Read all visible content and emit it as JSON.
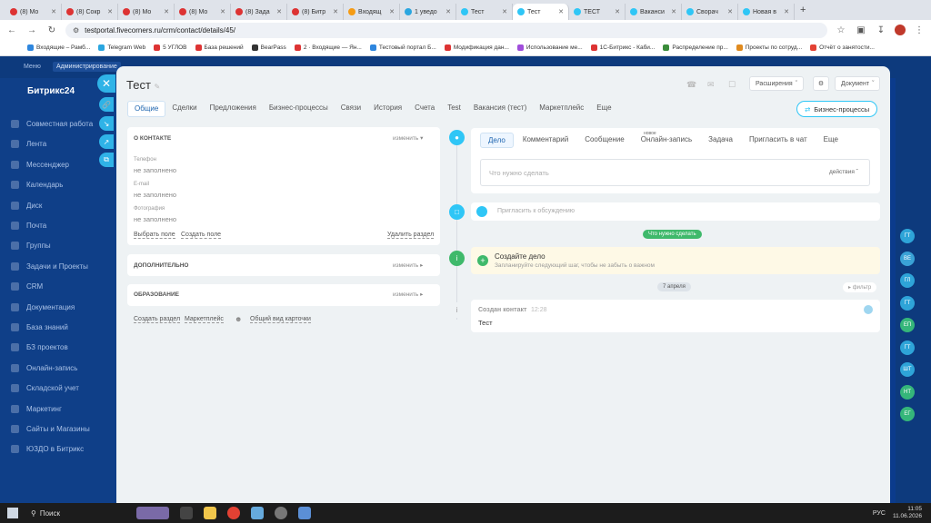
{
  "browser": {
    "tabs": [
      {
        "label": "(8) Мо",
        "color": "#d33"
      },
      {
        "label": "(8) Сокр",
        "color": "#d33"
      },
      {
        "label": "(8) Мо",
        "color": "#d33"
      },
      {
        "label": "(8) Мо",
        "color": "#d33"
      },
      {
        "label": "(8) Зада",
        "color": "#d33"
      },
      {
        "label": "(8) Битр",
        "color": "#d33"
      },
      {
        "label": "Входящ",
        "color": "#f59b14"
      },
      {
        "label": "1 уведо",
        "color": "#2aa6e0"
      },
      {
        "label": "Тест",
        "color": "#2fc6f6"
      },
      {
        "label": "Тест",
        "color": "#2fc6f6",
        "active": true
      },
      {
        "label": "ТЕСТ",
        "color": "#2fc6f6"
      },
      {
        "label": "Ваканси",
        "color": "#2fc6f6"
      },
      {
        "label": "Сворач",
        "color": "#2fc6f6"
      },
      {
        "label": "Новая в",
        "color": "#2fc6f6"
      }
    ],
    "url": "testportal.fivecorners.ru/crm/contact/details/45/",
    "bookmarks": [
      "Входящие – Рамб...",
      "Telegram Web",
      "5 УГЛОВ",
      "База решений",
      "BearPass",
      "2 · Входящие — Ян...",
      "Тестовый портал Б...",
      "Модификация дан...",
      "Использование ме...",
      "1С-Битрикс - Каби...",
      "Распределение пр...",
      "Проекты по сотруд...",
      "Отчёт о занятости..."
    ]
  },
  "bitrix": {
    "logo": "Битрикс24",
    "top_left": "Меню",
    "top_admin": "Администрирование",
    "menu": [
      "Совместная работа",
      "Лента",
      "Мессенджер",
      "Календарь",
      "Диск",
      "Почта",
      "Группы",
      "Задачи и Проекты",
      "CRM",
      "Документация",
      "База знаний",
      "БЗ проектов",
      "Онлайн-запись",
      "Складской учет",
      "Маркетинг",
      "Сайты и Магазины",
      "ЮЗДО в Битрикс"
    ],
    "right_avatars": [
      {
        "text": "ГТ",
        "color": "#2ea4d8"
      },
      {
        "text": "ВЕ",
        "color": "#3aa2d6"
      },
      {
        "text": "ГЛ",
        "color": "#2ea4d8"
      },
      {
        "text": "ГТ",
        "color": "#2ea4d8"
      },
      {
        "text": "ЕП",
        "color": "#35b67a"
      },
      {
        "text": "ГТ",
        "color": "#2ea4d8"
      },
      {
        "text": "ШТ",
        "color": "#2ea4d8"
      },
      {
        "text": "НТ",
        "color": "#35b67a"
      },
      {
        "text": "ЕГ",
        "color": "#35b67a"
      }
    ]
  },
  "header": {
    "title": "Тест",
    "extensions": "Расширения",
    "document": "Документ",
    "bp_button": "Бизнес-процессы"
  },
  "tabs": [
    "Общие",
    "Сделки",
    "Предложения",
    "Бизнес-процессы",
    "Связи",
    "История",
    "Счета",
    "Test",
    "Вакансия (тест)",
    "Маркетплейс",
    "Еще"
  ],
  "contact": {
    "section_title": "О контакте",
    "change": "изменить",
    "fields": [
      {
        "label": "Телефон",
        "value": "не заполнено"
      },
      {
        "label": "E-mail",
        "value": "не заполнено"
      },
      {
        "label": "Фотография",
        "value": "не заполнено"
      }
    ],
    "select_field": "Выбрать поле",
    "create_field": "Создать поле",
    "delete_section": "Удалить раздел"
  },
  "additional": {
    "title": "Дополнительно",
    "change": "изменить"
  },
  "education": {
    "title": "Образование",
    "change": "изменить"
  },
  "footer_links": {
    "create_section": "Создать раздел",
    "marketplace": "Маркетплейс",
    "common_view": "Общий вид карточки"
  },
  "activity": {
    "tabs": [
      "Дело",
      "Комментарий",
      "Сообщение",
      "Онлайн-запись",
      "Задача",
      "Пригласить в чат",
      "Еще"
    ],
    "new_badge": "новое",
    "placeholder": "Что нужно сделать",
    "actions": "действия",
    "invite": "Пригласить к обсуждению",
    "todo_pill": "Что нужно сделать",
    "create_title": "Создайте дело",
    "create_sub": "Запланируйте следующий шаг, чтобы не забыть о важном",
    "date_pill": "7 апреля",
    "filter": "фильтр",
    "event_title": "Создан контакт",
    "event_time": "12:28",
    "event_body": "Тест"
  },
  "taskbar": {
    "search": "Поиск",
    "time": "11:05",
    "date": "11.06.2026",
    "lang": "РУС"
  }
}
